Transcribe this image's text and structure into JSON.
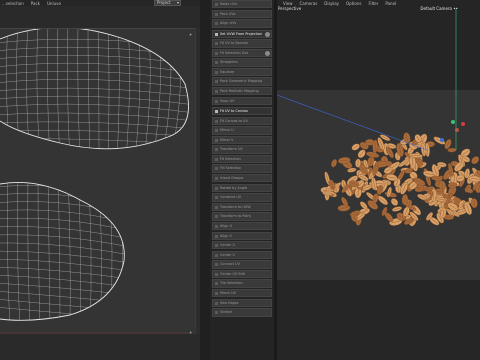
{
  "uv_editor": {
    "menu": [
      {
        "label": "...selection"
      },
      {
        "label": "Pack"
      },
      {
        "label": "Unluvo"
      }
    ],
    "dropdown": {
      "value": "Project"
    }
  },
  "command_panel": {
    "items": [
      {
        "label": "Relax UVs",
        "highlight": false
      },
      {
        "label": "Pack UVs",
        "highlight": false
      },
      {
        "label": "Align UVs",
        "highlight": false
      },
      {
        "label": "Set UVW From Projection",
        "highlight": true,
        "option": true
      },
      {
        "label": "Fit UV to Bounds",
        "highlight": false
      },
      {
        "label": "Fit Selection UVs",
        "highlight": false,
        "option": true
      },
      {
        "label": "Straighten",
        "highlight": false
      },
      {
        "label": "Equalize",
        "highlight": false
      },
      {
        "label": "Pack Geometric Mapping",
        "highlight": false
      },
      {
        "label": "Pack Realistic Mapping",
        "highlight": false
      },
      {
        "label": "Snap UV",
        "highlight": false
      },
      {
        "label": "Fit UV to Canvas",
        "highlight": true
      },
      {
        "label": "Fit Canvas to UV",
        "highlight": false
      },
      {
        "label": "Mirror U",
        "highlight": false
      },
      {
        "label": "Mirror V",
        "highlight": false
      },
      {
        "label": "Transform UV",
        "highlight": false
      },
      {
        "label": "Fit Selection",
        "highlight": false
      },
      {
        "label": "Fill Selection",
        "highlight": false
      },
      {
        "label": "Island Groups",
        "highlight": false
      },
      {
        "label": "Rotate by Angle",
        "highlight": false
      },
      {
        "label": "Constant UV",
        "highlight": false
      },
      {
        "label": "Transform to UVW",
        "highlight": false
      },
      {
        "label": "Transform to Point",
        "highlight": false
      },
      {
        "label": "Align U",
        "highlight": false
      },
      {
        "label": "Align V",
        "highlight": false
      },
      {
        "label": "Center U",
        "highlight": false
      },
      {
        "label": "Center V",
        "highlight": false
      },
      {
        "label": "Connect UV",
        "highlight": false
      },
      {
        "label": "Center UV Edit",
        "highlight": false
      },
      {
        "label": "Tile Selection",
        "highlight": false
      },
      {
        "label": "Mirror UV",
        "highlight": false
      },
      {
        "label": "Sew Edges",
        "highlight": false
      },
      {
        "label": "Stretch",
        "highlight": false
      }
    ]
  },
  "viewport": {
    "menu": [
      {
        "label": "View"
      },
      {
        "label": "Cameras"
      },
      {
        "label": "Display"
      },
      {
        "label": "Options"
      },
      {
        "label": "Filter"
      },
      {
        "label": "Panel"
      }
    ],
    "view_label": "Perspective",
    "camera_label": "Default Camera ••"
  },
  "colors": {
    "uv_wire": "#e6e6e6",
    "uv_grid": "#bdbdbd",
    "axis_y": "#3cc07a",
    "axis_x": "#3a6bd8",
    "seed_light": "#d9a067",
    "seed_dark": "#a96a3a",
    "highlight_text": "#ededed"
  }
}
